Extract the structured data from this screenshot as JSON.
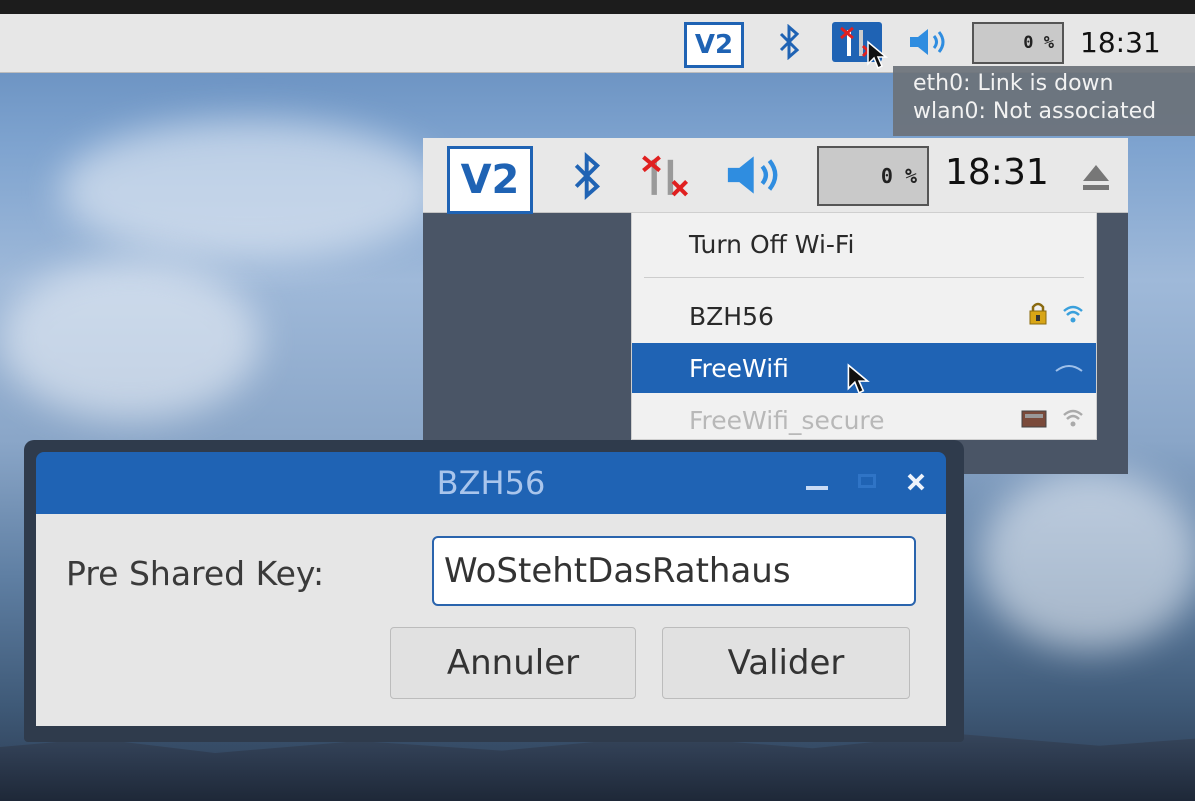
{
  "taskbar": {
    "vnc_icon": "vnc-icon",
    "bluetooth_icon": "bluetooth-icon",
    "network_icon": "network-disconnected-icon",
    "volume_icon": "volume-icon",
    "cpu_usage": "0 %",
    "clock": "18:31",
    "eject_icon": "eject-icon"
  },
  "network_tooltip": {
    "lines": [
      "eth0: Link is down",
      "wlan0: Not associated"
    ]
  },
  "wifi_menu": {
    "toggle_label": "Turn Off Wi-Fi",
    "networks": [
      {
        "ssid": "BZH56",
        "secured": true,
        "state": "normal"
      },
      {
        "ssid": "FreeWifi",
        "secured": false,
        "state": "selected"
      },
      {
        "ssid": "FreeWifi_secure",
        "secured": true,
        "state": "disabled"
      }
    ]
  },
  "dialog": {
    "title": "BZH56",
    "psk_label": "Pre Shared Key:",
    "psk_value": "WoStehtDasRathaus",
    "cancel_label": "Annuler",
    "ok_label": "Valider"
  },
  "colors": {
    "accent": "#1f63b4",
    "taskbar_bg": "#e7e7e7",
    "menu_bg": "#f1f1f1",
    "network_error": "#e02020"
  }
}
